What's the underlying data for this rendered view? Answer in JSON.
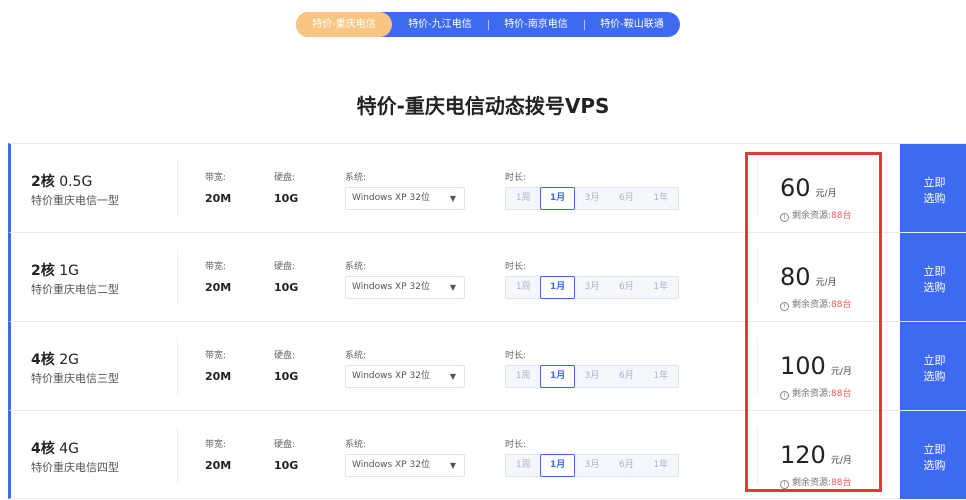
{
  "tabs": [
    "特价-重庆电信",
    "特价-九江电信",
    "特价-南京电信",
    "特价-鞍山联通"
  ],
  "active_tab": 0,
  "title": "特价-重庆电信动态拨号VPS",
  "labels": {
    "bandwidth": "带宽:",
    "disk": "硬盘:",
    "system": "系统:",
    "duration": "时长:",
    "stock_prefix": "剩余资源:",
    "buy_line1": "立即",
    "buy_line2": "选购"
  },
  "durations": [
    "1周",
    "1月",
    "3月",
    "6月",
    "1年"
  ],
  "plans": [
    {
      "spec_bold": "2核",
      "spec_rest": " 0.5G",
      "name": "特价重庆电信一型",
      "bandwidth": "20M",
      "disk": "10G",
      "system": "Windows XP 32位",
      "duration": "1月",
      "price": "60",
      "unit": "元/月",
      "stock": "88",
      "stock_unit": "台"
    },
    {
      "spec_bold": "2核",
      "spec_rest": " 1G",
      "name": "特价重庆电信二型",
      "bandwidth": "20M",
      "disk": "10G",
      "system": "Windows XP 32位",
      "duration": "1月",
      "price": "80",
      "unit": "元/月",
      "stock": "88",
      "stock_unit": "台"
    },
    {
      "spec_bold": "4核",
      "spec_rest": " 2G",
      "name": "特价重庆电信三型",
      "bandwidth": "20M",
      "disk": "10G",
      "system": "Windows XP 32位",
      "duration": "1月",
      "price": "100",
      "unit": "元/月",
      "stock": "88",
      "stock_unit": "台"
    },
    {
      "spec_bold": "4核",
      "spec_rest": " 4G",
      "name": "特价重庆电信四型",
      "bandwidth": "20M",
      "disk": "10G",
      "system": "Windows XP 32位",
      "duration": "1月",
      "price": "120",
      "unit": "元/月",
      "stock": "88",
      "stock_unit": "台"
    }
  ],
  "colors": {
    "primary": "#3d6af1",
    "active_tab": "#f8c682",
    "stock_count": "#f25c54",
    "highlight": "#e53935"
  }
}
